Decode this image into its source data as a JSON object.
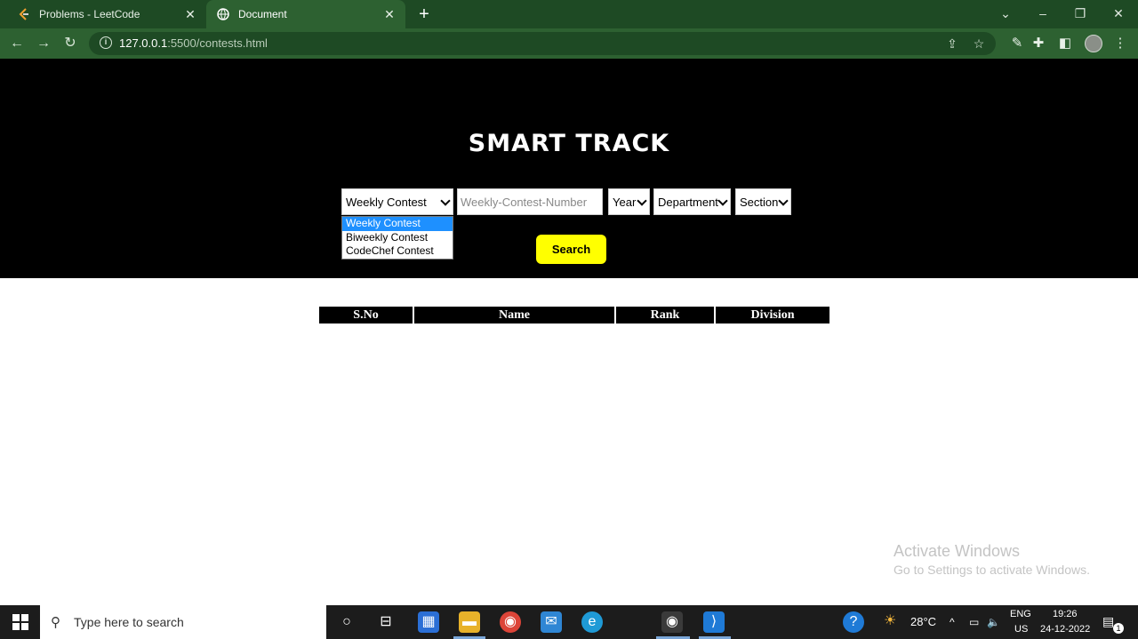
{
  "browser": {
    "tabs": [
      {
        "title": "Problems - LeetCode",
        "active": false
      },
      {
        "title": "Document",
        "active": true
      }
    ],
    "url_host": "127.0.0.1",
    "url_rest": ":5500/contests.html"
  },
  "page": {
    "title": "SMART TRACK",
    "contest_select": {
      "selected": "Weekly Contest",
      "options": [
        "Weekly Contest",
        "Biweekly Contest",
        "CodeChef Contest"
      ]
    },
    "contest_number_placeholder": "Weekly-Contest-Number",
    "year_select": "Year",
    "department_select": "Department",
    "section_select": "Section",
    "search_label": "Search",
    "table_headers": [
      "S.No",
      "Name",
      "Rank",
      "Division"
    ]
  },
  "watermark": {
    "line1": "Activate Windows",
    "line2": "Go to Settings to activate Windows."
  },
  "taskbar": {
    "search_placeholder": "Type here to search",
    "temperature": "28°C",
    "language": "ENG",
    "region": "US",
    "time": "19:26",
    "date": "24-12-2022",
    "notification_count": "1"
  }
}
